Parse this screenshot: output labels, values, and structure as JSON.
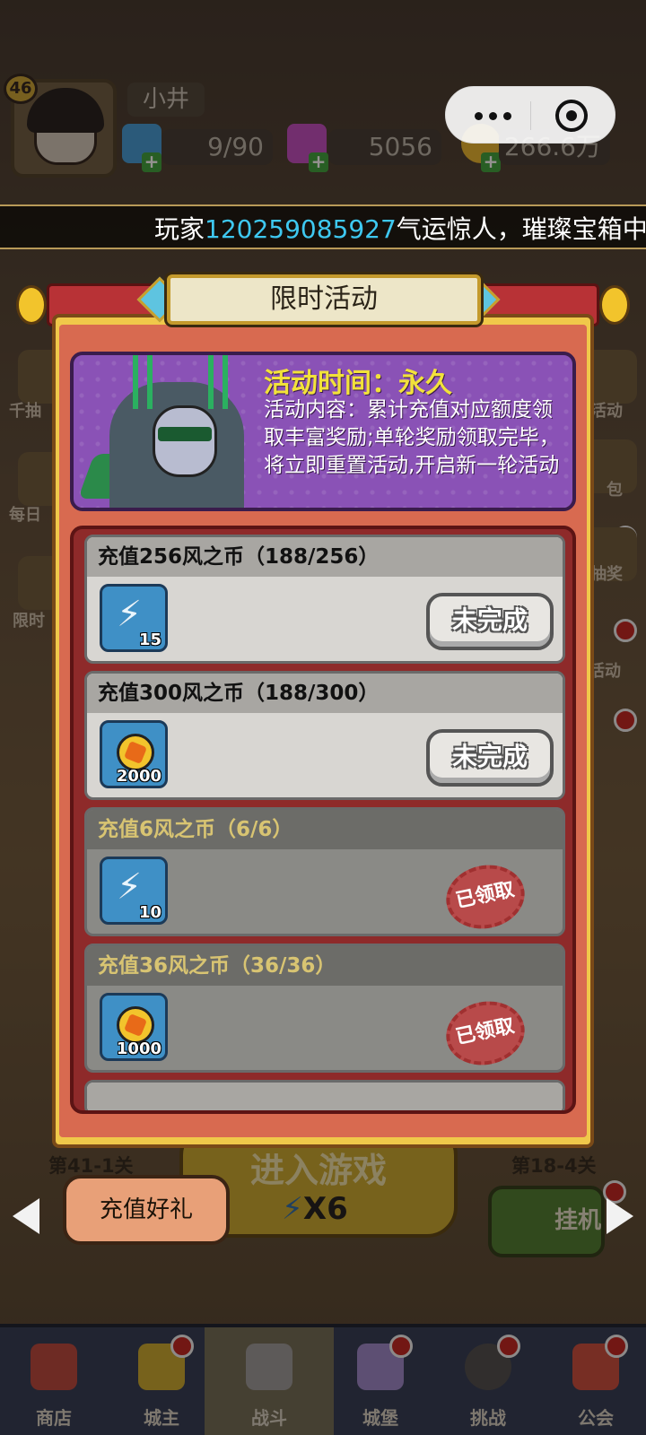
{
  "player": {
    "level": "46",
    "name": "小井",
    "energy": "9/90",
    "gems": "5056",
    "gold": "266.6万"
  },
  "marquee": {
    "prefix": "玩家",
    "player_id": "120259085927",
    "suffix": "气运惊人，璀璨宝箱中"
  },
  "modal": {
    "title": "限时活动",
    "banner": {
      "time": "活动时间：永久",
      "description": "活动内容：累计充值对应额度领取丰富奖励;单轮奖励领取完毕，将立即重置活动,开启新一轮活动"
    },
    "tasks": [
      {
        "title": "充值256风之币（188/256）",
        "reward_icon": "energy-bolt-icon",
        "reward_count": "15",
        "status": "未完成",
        "state": "incomplete"
      },
      {
        "title": "充值300风之币（188/300）",
        "reward_icon": "gold-coin-icon",
        "reward_count": "2000",
        "status": "未完成",
        "state": "incomplete"
      },
      {
        "title": "充值6风之币（6/6）",
        "reward_icon": "energy-bolt-icon",
        "reward_count": "10",
        "status": "已领取",
        "state": "claimed"
      },
      {
        "title": "充值36风之币（36/36）",
        "reward_icon": "gold-coin-icon",
        "reward_count": "1000",
        "status": "已领取",
        "state": "claimed"
      }
    ]
  },
  "side_labels": {
    "left_1": "千抽",
    "left_2": "每日",
    "left_3": "限时",
    "right_1": "活动",
    "right_2": "包",
    "right_3": "抽奖",
    "right_4": "活动"
  },
  "bottom": {
    "stage_left": "第41-1关",
    "stage_right": "第18-4关",
    "enter_game": "进入游戏",
    "enter_cost": "X6",
    "recharge_gift": "充值好礼",
    "idle": "挂机"
  },
  "tabs": [
    {
      "label": "商店"
    },
    {
      "label": "城主"
    },
    {
      "label": "战斗"
    },
    {
      "label": "城堡"
    },
    {
      "label": "挑战"
    },
    {
      "label": "公会"
    }
  ],
  "colors": {
    "accent_gold": "#f0c84a",
    "modal_red": "#b83236",
    "banner_purple": "#8a52b6",
    "highlight_cyan": "#3ec8f0",
    "notify_red": "#c0201c"
  }
}
